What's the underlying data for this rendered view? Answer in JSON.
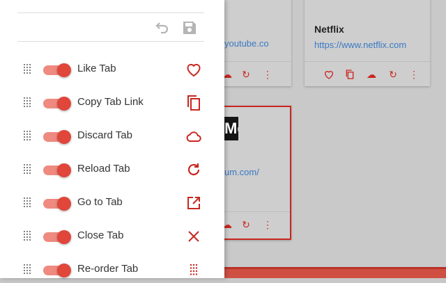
{
  "cards": {
    "a": {
      "link": "youtube.co"
    },
    "b": {
      "title": "Netflix",
      "link": "https://www.netflix.com"
    },
    "c": {
      "link": "um.com/",
      "logo_text": "Me"
    }
  },
  "colors": {
    "accent": "#c9261f",
    "track": "#ee8a80",
    "knob": "#e0463a"
  },
  "toolbar": {
    "icons": [
      "undo-icon",
      "save-icon"
    ]
  },
  "actions": [
    {
      "label": "Like Tab",
      "enabled": true,
      "icon": "heart-icon"
    },
    {
      "label": "Copy Tab Link",
      "enabled": true,
      "icon": "copy-icon"
    },
    {
      "label": "Discard Tab",
      "enabled": true,
      "icon": "cloud-icon"
    },
    {
      "label": "Reload Tab",
      "enabled": true,
      "icon": "reload-icon"
    },
    {
      "label": "Go to Tab",
      "enabled": true,
      "icon": "open-in-new-icon"
    },
    {
      "label": "Close Tab",
      "enabled": true,
      "icon": "close-icon"
    },
    {
      "label": "Re-order Tab",
      "enabled": true,
      "icon": "drag-grid-icon"
    }
  ]
}
